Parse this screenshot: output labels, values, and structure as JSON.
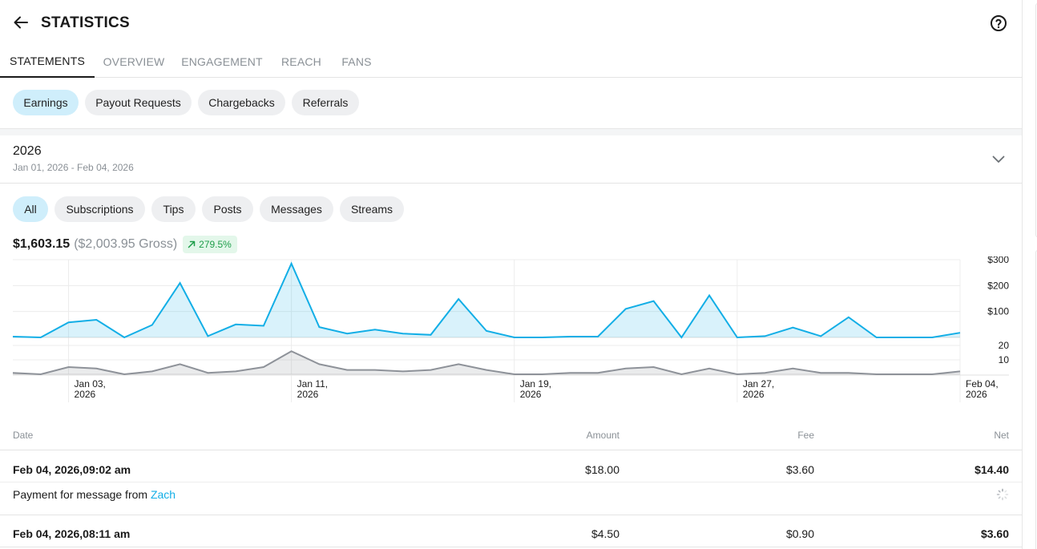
{
  "header": {
    "title": "STATISTICS"
  },
  "tabs": [
    {
      "label": "STATEMENTS"
    },
    {
      "label": "OVERVIEW"
    },
    {
      "label": "ENGAGEMENT"
    },
    {
      "label": "REACH"
    },
    {
      "label": "FANS"
    }
  ],
  "subtabs": [
    {
      "label": "Earnings"
    },
    {
      "label": "Payout Requests"
    },
    {
      "label": "Chargebacks"
    },
    {
      "label": "Referrals"
    }
  ],
  "period": {
    "year": "2026",
    "range": "Jan 01, 2026 - Feb 04, 2026"
  },
  "filters": [
    {
      "label": "All"
    },
    {
      "label": "Subscriptions"
    },
    {
      "label": "Tips"
    },
    {
      "label": "Posts"
    },
    {
      "label": "Messages"
    },
    {
      "label": "Streams"
    }
  ],
  "summary": {
    "net": "$1,603.15",
    "gross": "($2,003.95 Gross)",
    "change": "279.5%"
  },
  "colors": {
    "accent": "#12aee6",
    "active_pill": "#cfeefb",
    "positive": "#1e9e4a",
    "gray_series": "#8e9299"
  },
  "chart_data": {
    "type": "area",
    "x": [
      "Jan 01, 2026",
      "Jan 02, 2026",
      "Jan 03, 2026",
      "Jan 04, 2026",
      "Jan 05, 2026",
      "Jan 06, 2026",
      "Jan 07, 2026",
      "Jan 08, 2026",
      "Jan 09, 2026",
      "Jan 10, 2026",
      "Jan 11, 2026",
      "Jan 12, 2026",
      "Jan 13, 2026",
      "Jan 14, 2026",
      "Jan 15, 2026",
      "Jan 16, 2026",
      "Jan 17, 2026",
      "Jan 18, 2026",
      "Jan 19, 2026",
      "Jan 20, 2026",
      "Jan 21, 2026",
      "Jan 22, 2026",
      "Jan 23, 2026",
      "Jan 24, 2026",
      "Jan 25, 2026",
      "Jan 26, 2026",
      "Jan 27, 2026",
      "Jan 28, 2026",
      "Jan 29, 2026",
      "Jan 30, 2026",
      "Jan 31, 2026",
      "Feb 01, 2026",
      "Feb 02, 2026",
      "Feb 03, 2026",
      "Feb 04, 2026"
    ],
    "x_ticks": [
      {
        "line1": "Jan 03,",
        "line2": "2026",
        "index": 2
      },
      {
        "line1": "Jan 11,",
        "line2": "2026",
        "index": 10
      },
      {
        "line1": "Jan 19,",
        "line2": "2026",
        "index": 18
      },
      {
        "line1": "Jan 27,",
        "line2": "2026",
        "index": 26
      },
      {
        "line1": "Feb 04,",
        "line2": "2026",
        "index": 34
      }
    ],
    "series": [
      {
        "values": [
          3,
          0,
          58,
          68,
          0,
          48,
          210,
          5,
          50,
          45,
          285,
          40,
          15,
          30,
          15,
          10,
          148,
          25,
          0,
          0,
          3,
          3,
          110,
          140,
          0,
          162,
          0,
          5,
          38,
          5,
          78,
          0,
          0,
          0,
          18
        ],
        "y_ticks": [
          "$300",
          "$200",
          "$100"
        ],
        "y_tick_values": [
          300,
          200,
          100
        ],
        "ylim": [
          0,
          300
        ]
      },
      {
        "values": [
          1,
          0,
          5,
          4,
          0,
          2,
          7,
          1,
          2,
          5,
          16,
          7,
          3,
          3,
          2,
          3,
          7,
          3,
          0,
          0,
          1,
          1,
          4,
          5,
          0,
          4,
          0,
          1,
          4,
          1,
          1,
          0,
          0,
          0,
          2
        ],
        "y_ticks": [
          "20",
          "10"
        ],
        "y_tick_values": [
          20,
          10
        ],
        "ylim": [
          0,
          20
        ]
      }
    ]
  },
  "table": {
    "headers": {
      "date": "Date",
      "amount": "Amount",
      "fee": "Fee",
      "net": "Net"
    },
    "rows": [
      {
        "date": "Feb 04, 2026,09:02 am",
        "amount": "$18.00",
        "fee": "$3.60",
        "net": "$14.40",
        "desc_prefix": "Payment for message from ",
        "desc_link": "Zach"
      },
      {
        "date": "Feb 04, 2026,08:11 am",
        "amount": "$4.50",
        "fee": "$0.90",
        "net": "$3.60"
      }
    ]
  }
}
